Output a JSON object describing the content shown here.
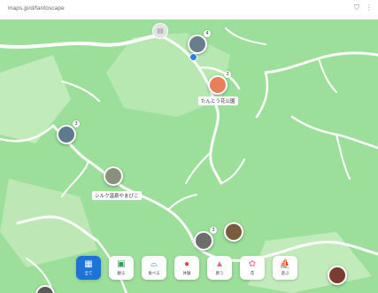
{
  "browser": {
    "url": "maps.jp/d/fantoscape"
  },
  "top_icons": [
    "shield-icon",
    "more-icon"
  ],
  "map": {
    "colors": {
      "land": "#9bdf9a",
      "light_land": "#d4efcc",
      "river": "#ffffff",
      "background": "#ffffff"
    },
    "places": [
      {
        "name": "たんとう花公園",
        "count": "3",
        "icon": "flower-garden-photo"
      },
      {
        "name": "シルク温泉やまびこ",
        "count": "",
        "icon": "onsen-photo"
      }
    ],
    "cluster_counts": [
      "4",
      "3",
      "3",
      "2"
    ]
  },
  "categories": [
    {
      "label": "全て",
      "icon": "all-icon",
      "active": true
    },
    {
      "label": "観る",
      "icon": "landscape-icon",
      "active": false
    },
    {
      "label": "食べる",
      "icon": "food-icon",
      "active": false
    },
    {
      "label": "体験",
      "icon": "balloon-icon",
      "active": false
    },
    {
      "label": "買う",
      "icon": "shopping-bag-icon",
      "active": false
    },
    {
      "label": "花",
      "icon": "flower-icon",
      "active": false
    },
    {
      "label": "遊ぶ",
      "icon": "sailboat-icon",
      "active": false
    }
  ]
}
